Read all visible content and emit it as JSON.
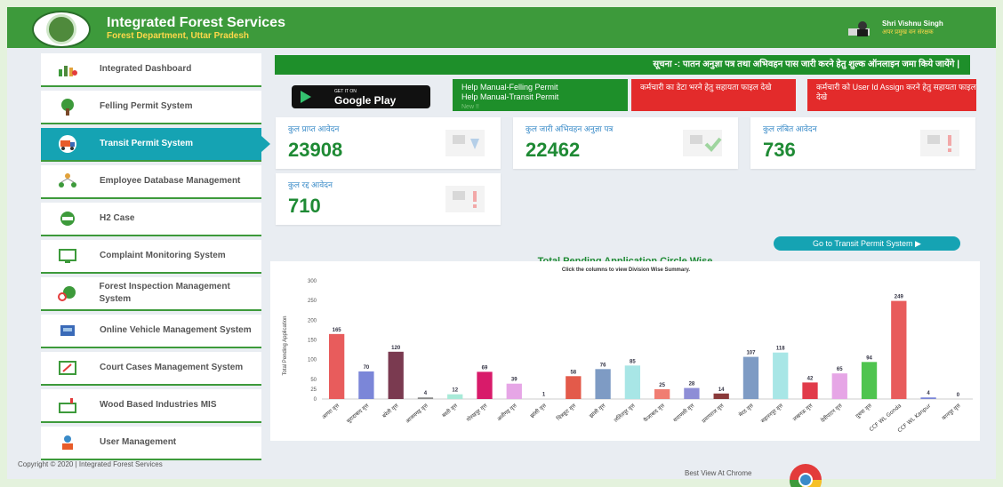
{
  "header": {
    "title": "Integrated Forest Services",
    "subtitle": "Forest Department, Uttar Pradesh",
    "user_name": "Shri Vishnu Singh",
    "user_role": "अपर प्रमुख वन संरक्षक"
  },
  "sidebar": {
    "items": [
      {
        "label": "Integrated Dashboard",
        "icon": "dashboard-chart-icon"
      },
      {
        "label": "Felling Permit System",
        "icon": "tree-icon"
      },
      {
        "label": "Transit Permit System",
        "icon": "truck-icon",
        "active": true
      },
      {
        "label": "Employee Database Management",
        "icon": "people-network-icon"
      },
      {
        "label": "H2 Case",
        "icon": "handshake-icon"
      },
      {
        "label": "Complaint Monitoring System",
        "icon": "monitor-icon"
      },
      {
        "label": "Forest Inspection Management System",
        "icon": "inspection-icon"
      },
      {
        "label": "Online Vehicle Management System",
        "icon": "vehicle-icon"
      },
      {
        "label": "Court Cases Management System",
        "icon": "gavel-icon"
      },
      {
        "label": "Wood Based Industries MIS",
        "icon": "factory-icon"
      },
      {
        "label": "User Management",
        "icon": "users-icon"
      }
    ]
  },
  "notice": "सूचना -: पातन अनुज्ञा पत्र तथा अभिवहन पास जारी करने हेतु शुल्क ऑनलाइन जमा किये जायेंगे |",
  "google_play": {
    "small": "GET IT ON",
    "big": "Google Play"
  },
  "help_buttons": {
    "felling": "Help Manual-Felling Permit",
    "transit": "Help Manual-Transit Permit",
    "new_badge": "New !!",
    "employee_data": "कर्मचारी का डेटा भरने हेतु सहायता फाइल देखे",
    "user_id_assign": "कर्मचारी को User Id Assign करने हेतु सहायता फाइल देखे"
  },
  "cards": [
    {
      "title": "कुल प्राप्त आवेदन",
      "value": "23908"
    },
    {
      "title": "कुल जारी अभिवहन अनुज्ञा पत्र",
      "value": "22462"
    },
    {
      "title": "कुल लंबित आवेदन",
      "value": "736"
    },
    {
      "title": "कुल रद्द आवेदन",
      "value": "710"
    }
  ],
  "goto_button": "Go to Transit Permit System ▶",
  "colors": {
    "brand_green": "#3d9a3b",
    "accent_teal": "#15a3b3",
    "alert_red": "#e32b2b",
    "value_green": "#1e8a34"
  },
  "chart_data": {
    "type": "bar",
    "title": "Total Pending Application Circle Wise",
    "subtitle": "Click the columns to view Division Wise Summary.",
    "ylabel": "Total Pending Application",
    "xlabel": "",
    "ylim": [
      0,
      300
    ],
    "yticks": [
      0,
      25,
      50,
      100,
      150,
      200,
      250,
      300
    ],
    "grid": false,
    "categories": [
      "आगरा वृत्त",
      "मुरादाबाद वृत्त",
      "बरेली वृत्त",
      "आजमगढ़ वृत्त",
      "बस्ती वृत्त",
      "गोरखपुर वृत्त",
      "अलीगढ़ वृत्त",
      "झांसी वृत्त",
      "चित्रकूट वृत्त",
      "झांसी वृत्त",
      "ललितपुर वृत्त",
      "फैजाबाद वृत्त",
      "वाराणसी वृत्त",
      "प्रयागराज वृत्त",
      "मेरठ वृत्त",
      "सहारनपुर वृत्त",
      "लखनऊ वृत्त",
      "देवीपाटन वृत्त",
      "दुधवा वृत्त",
      "CCF WL Gonda",
      "CCF WL Kanpur",
      "कानपुर वृत्त"
    ],
    "values": [
      165,
      70,
      120,
      4,
      12,
      69,
      39,
      1,
      58,
      76,
      85,
      25,
      28,
      14,
      107,
      118,
      42,
      65,
      94,
      249,
      4,
      0
    ],
    "colors": [
      "#e85c5c",
      "#7b86d8",
      "#7a3a50",
      "#8a8a8a",
      "#a8ead8",
      "#d81b6a",
      "#e6a6e6",
      "#cccccc",
      "#e35a4a",
      "#7e9bc4",
      "#a8e6e6",
      "#f07d72",
      "#8e8ed6",
      "#8a3a3a",
      "#7e9bc4",
      "#a8e6e6",
      "#e13b4a",
      "#e6a6e6",
      "#4fc44f",
      "#e85c5c",
      "#7b86d8",
      "#cccccc"
    ]
  },
  "footer": {
    "copyright": "Copyright © 2020 | Integrated Forest Services",
    "best_view": "Best View At Chrome"
  }
}
